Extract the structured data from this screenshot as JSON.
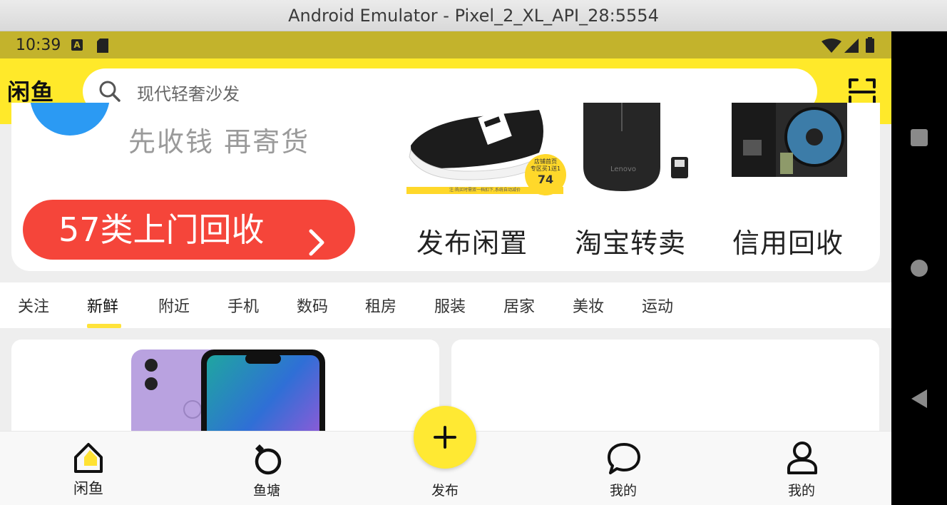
{
  "window": {
    "title": "Android Emulator - Pixel_2_XL_API_28:5554"
  },
  "status_bar": {
    "time": "10:39"
  },
  "header": {
    "logo": "闲鱼",
    "search_placeholder": "现代轻奢沙发"
  },
  "banner": {
    "slogan": "先收钱 再寄货",
    "recycle_button": "57类上门回收",
    "features": [
      {
        "label": "发布闲置"
      },
      {
        "label": "淘宝转卖"
      },
      {
        "label": "信用回收"
      }
    ],
    "promo_badge": {
      "top": "店铺首页",
      "mid": "专区买1送1",
      "number": "74"
    },
    "promo_note": "注:购买时需双一档扣下,系统自动减价",
    "mouse_brand": "Lenovo"
  },
  "tabs": {
    "items": [
      "关注",
      "新鲜",
      "附近",
      "手机",
      "数码",
      "租房",
      "服装",
      "居家",
      "美妆",
      "运动"
    ],
    "active_index": 1
  },
  "bottom_nav": {
    "items": [
      {
        "label": "闲鱼",
        "icon": "home-icon",
        "active": true
      },
      {
        "label": "鱼塘",
        "icon": "ring-icon"
      },
      {
        "label": "发布",
        "icon": "plus-icon"
      },
      {
        "label": "我的",
        "icon": "message-icon"
      },
      {
        "label": "我的",
        "icon": "user-icon"
      }
    ]
  },
  "colors": {
    "brand_yellow": "#ffe92a",
    "status_bar": "#c3b32c",
    "recycle_red": "#f5453a",
    "accent_blue": "#2b9af3"
  }
}
